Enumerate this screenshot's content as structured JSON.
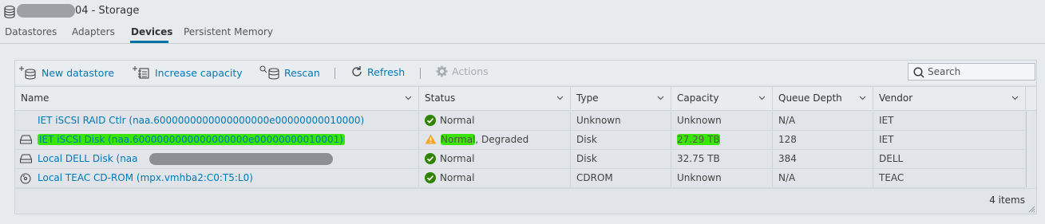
{
  "header": {
    "title_suffix": "04 - Storage"
  },
  "tabs": [
    {
      "label": "Datastores"
    },
    {
      "label": "Adapters"
    },
    {
      "label": "Devices",
      "active": true
    },
    {
      "label": "Persistent Memory"
    }
  ],
  "toolbar": {
    "new_datastore": "New datastore",
    "increase_capacity": "Increase capacity",
    "rescan": "Rescan",
    "refresh": "Refresh",
    "actions": "Actions",
    "search_placeholder": "Search"
  },
  "columns": [
    "Name",
    "Status",
    "Type",
    "Capacity",
    "Queue Depth",
    "Vendor"
  ],
  "rows": [
    {
      "name": "IET iSCSI RAID Ctlr (naa.6000000000000000000e00000000010000)",
      "status": "Normal",
      "status_extra": "",
      "type": "Unknown",
      "capacity": "Unknown",
      "queue_depth": "N/A",
      "vendor": "IET",
      "icon": "none-icon"
    },
    {
      "name": "IET iSCSI Disk (naa.6000000000000000000e00000000010001)",
      "status": "Normal",
      "status_extra": ", Degraded",
      "type": "Disk",
      "capacity": "27.29 TB",
      "queue_depth": "128",
      "vendor": "IET",
      "icon": "disk-icon",
      "warning": true
    },
    {
      "name": "Local DELL Disk (naa",
      "status": "Normal",
      "status_extra": "",
      "type": "Disk",
      "capacity": "32.75 TB",
      "queue_depth": "384",
      "vendor": "DELL",
      "icon": "disk-icon"
    },
    {
      "name": "Local TEAC CD-ROM (mpx.vmhba2:C0:T5:L0)",
      "status": "Normal",
      "status_extra": "",
      "type": "CDROM",
      "capacity": "Unknown",
      "queue_depth": "N/A",
      "vendor": "TEAC",
      "icon": "cdrom-icon"
    }
  ],
  "footer": {
    "items_count": "4 items"
  },
  "colors": {
    "link": "#0079b8",
    "ok": "#2f8400",
    "warning": "#f5a623",
    "highlight": "#39e600"
  }
}
